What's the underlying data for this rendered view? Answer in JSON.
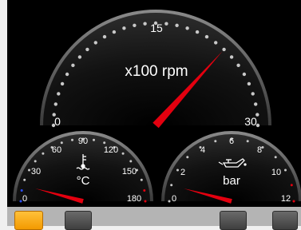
{
  "colors": {
    "background": "#000000",
    "dial_face": "#1b1b1b",
    "dial_rim": "#5a5a5a",
    "needle": "#e3000f",
    "cold_marker": "#2b4fff",
    "hot_marker": "#e3000f",
    "button_active": "#f7a81b",
    "button_inactive": "#555555",
    "button_bar": "#b4b4b4"
  },
  "gauges": {
    "rpm": {
      "unit_label": "x100 rpm",
      "tick_labels": [
        "0",
        "15",
        "30"
      ],
      "min": 0,
      "max": 30,
      "value": 22
    },
    "coolant": {
      "unit_label": "°C",
      "icon": "coolant-temperature-icon",
      "tick_labels": [
        "0",
        "30",
        "60",
        "90",
        "120",
        "150",
        "180"
      ],
      "min": 0,
      "max": 180,
      "value": 15
    },
    "oil": {
      "unit_label": "bar",
      "icon": "oil-can-icon",
      "tick_labels": [
        "0",
        "2",
        "4",
        "6",
        "8",
        "10",
        "12"
      ],
      "min": 0,
      "max": 12,
      "value": 1
    }
  },
  "buttons": [
    {
      "name": "softkey-1",
      "active": true
    },
    {
      "name": "softkey-2",
      "active": false
    },
    {
      "name": "softkey-3",
      "active": false
    },
    {
      "name": "softkey-4",
      "active": false
    }
  ]
}
